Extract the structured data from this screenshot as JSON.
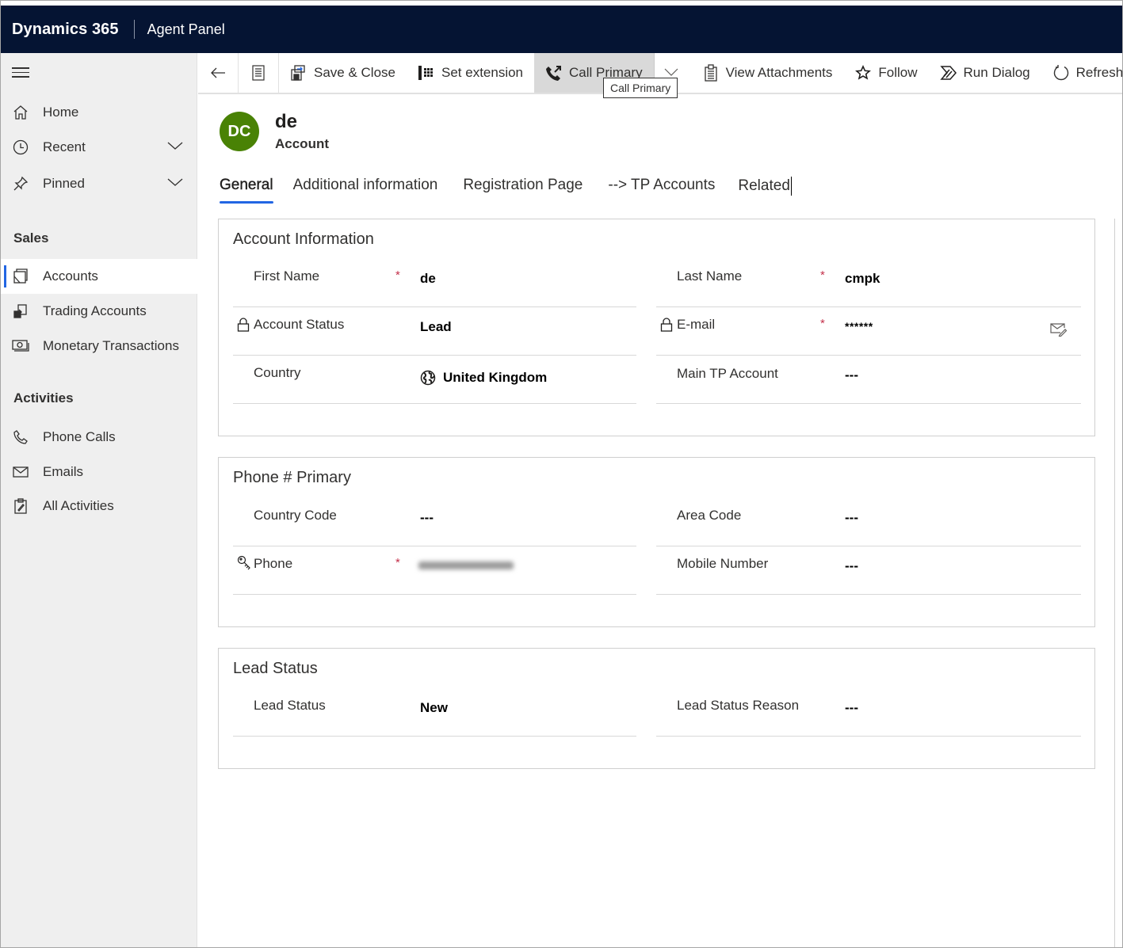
{
  "app": {
    "brand": "Dynamics 365",
    "app_name": "Agent Panel"
  },
  "sidebar": {
    "top_items": [
      {
        "label": "Home",
        "icon": "home-icon"
      },
      {
        "label": "Recent",
        "icon": "clock-icon",
        "expandable": true
      },
      {
        "label": "Pinned",
        "icon": "pin-icon",
        "expandable": true
      }
    ],
    "groups": [
      {
        "title": "Sales",
        "items": [
          {
            "label": "Accounts",
            "icon": "accounts-icon",
            "active": true
          },
          {
            "label": "Trading Accounts",
            "icon": "trading-accounts-icon"
          },
          {
            "label": "Monetary Transactions",
            "icon": "money-icon"
          }
        ]
      },
      {
        "title": "Activities",
        "items": [
          {
            "label": "Phone Calls",
            "icon": "phone-icon"
          },
          {
            "label": "Emails",
            "icon": "mail-icon"
          },
          {
            "label": "All Activities",
            "icon": "clipboard-icon"
          }
        ]
      }
    ]
  },
  "commandbar": {
    "back_icon": "back-arrow-icon",
    "form_icon": "form-icon",
    "buttons": [
      {
        "label": "Save & Close",
        "icon": "save-close-icon"
      },
      {
        "label": "Set extension",
        "icon": "dialpad-icon"
      },
      {
        "label": "Call Primary",
        "icon": "phone-call-icon",
        "hovered": true
      },
      {
        "label": "View Attachments",
        "icon": "attachments-icon"
      },
      {
        "label": "Follow",
        "icon": "star-icon"
      },
      {
        "label": "Run Dialog",
        "icon": "run-dialog-icon"
      },
      {
        "label": "Refresh",
        "icon": "refresh-icon"
      }
    ],
    "tooltip": "Call Primary"
  },
  "record": {
    "initials": "DC",
    "avatar_color": "#498205",
    "title": "de",
    "entity": "Account"
  },
  "tabs": [
    {
      "label": "General",
      "active": true
    },
    {
      "label": "Additional information"
    },
    {
      "label": "Registration Page"
    },
    {
      "label": "--> TP Accounts"
    },
    {
      "label": "Related"
    }
  ],
  "sections": {
    "account_information": {
      "title": "Account Information",
      "fields": {
        "first_name": {
          "label": "First Name",
          "value": "de",
          "required": "*"
        },
        "last_name": {
          "label": "Last Name",
          "value": "cmpk",
          "required": "*"
        },
        "account_status": {
          "label": "Account Status",
          "value": "Lead",
          "locked": true
        },
        "email": {
          "label": "E-mail",
          "value": "******",
          "required": "*",
          "locked": true
        },
        "country": {
          "label": "Country",
          "value": "United Kingdom"
        },
        "main_tp_account": {
          "label": "Main TP Account",
          "value": "---"
        }
      }
    },
    "phone_primary": {
      "title": "Phone # Primary",
      "fields": {
        "country_code": {
          "label": "Country Code",
          "value": "---"
        },
        "area_code": {
          "label": "Area Code",
          "value": "---"
        },
        "phone": {
          "label": "Phone",
          "value": "[redacted]",
          "required": "*"
        },
        "mobile_number": {
          "label": "Mobile Number",
          "value": "---"
        }
      }
    },
    "lead_status": {
      "title": "Lead Status",
      "fields": {
        "lead_status": {
          "label": "Lead Status",
          "value": "New"
        },
        "lead_status_reason": {
          "label": "Lead Status Reason",
          "value": "---"
        }
      }
    }
  },
  "colors": {
    "topbar": "#051433",
    "accent": "#2266e3",
    "link": "#2b579a",
    "required": "#c4314b"
  }
}
